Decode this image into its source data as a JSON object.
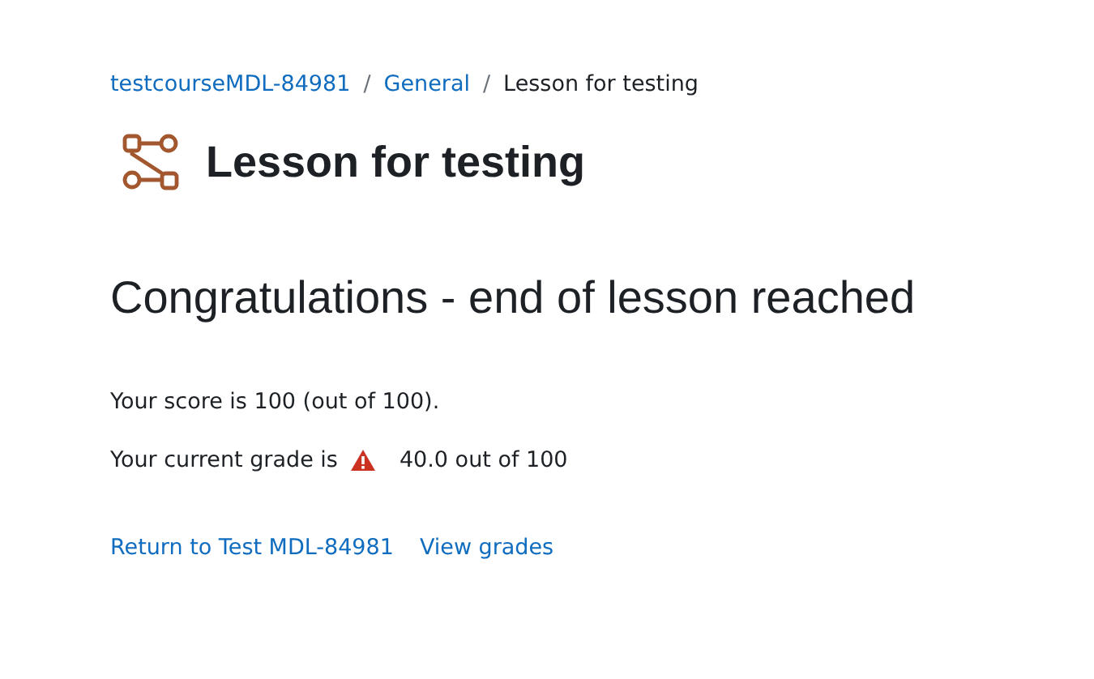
{
  "breadcrumb": [
    {
      "label": "testcourseMDL-84981",
      "kind": "link"
    },
    {
      "label": "/",
      "kind": "separator"
    },
    {
      "label": "General",
      "kind": "link"
    },
    {
      "label": "/",
      "kind": "separator"
    },
    {
      "label": "Lesson for testing",
      "kind": "current"
    }
  ],
  "page_title": "Lesson for testing",
  "heading": "Congratulations - end of lesson reached",
  "score": "Your score is 100 (out of 100).",
  "grade": {
    "label": "Your current grade is",
    "warning": true,
    "value": "40.0 out of 100"
  },
  "links": [
    "Return to Test MDL-84981",
    "View grades"
  ]
}
